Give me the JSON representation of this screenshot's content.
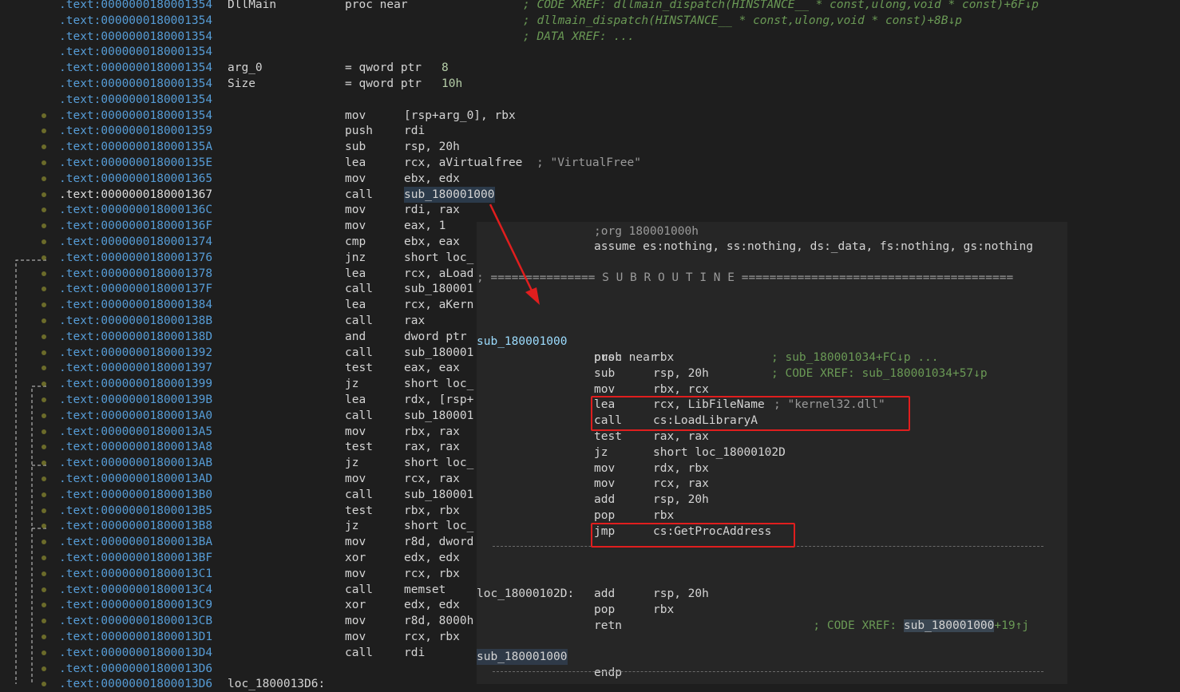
{
  "lines": [
    {
      "addr": ".text:0000000180001354",
      "label": "DllMain",
      "mn": "proc near",
      "op": "",
      "comment": "; CODE XREF: dllmain_dispatch(HINSTANCE__ * const,ulong,void * const)+6F↓p"
    },
    {
      "addr": ".text:0000000180001354",
      "label": "",
      "mn": "",
      "op": "",
      "comment": "; dllmain_dispatch(HINSTANCE__ * const,ulong,void * const)+8B↓p"
    },
    {
      "addr": ".text:0000000180001354",
      "label": "",
      "mn": "",
      "op": "",
      "comment": "; DATA XREF: ..."
    },
    {
      "addr": ".text:0000000180001354",
      "label": "",
      "mn": "",
      "op": "",
      "comment": ""
    },
    {
      "addr": ".text:0000000180001354",
      "label": "arg_0",
      "mn": "= qword ptr",
      "op": "8",
      "comment": ""
    },
    {
      "addr": ".text:0000000180001354",
      "label": "Size",
      "mn": "= qword ptr",
      "op": "10h",
      "comment": ""
    },
    {
      "addr": ".text:0000000180001354",
      "label": "",
      "mn": "",
      "op": "",
      "comment": ""
    },
    {
      "addr": ".text:0000000180001354",
      "label": "",
      "mn": "mov",
      "op": "[rsp+arg_0], rbx",
      "comment": ""
    },
    {
      "addr": ".text:0000000180001359",
      "label": "",
      "mn": "push",
      "op": "rdi",
      "comment": ""
    },
    {
      "addr": ".text:000000018000135A",
      "label": "",
      "mn": "sub",
      "op": "rsp, 20h",
      "comment": ""
    },
    {
      "addr": ".text:000000018000135E",
      "label": "",
      "mn": "lea",
      "op": "rcx, aVirtualfree",
      "comment": "; \"VirtualFree\""
    },
    {
      "addr": ".text:0000000180001365",
      "label": "",
      "mn": "mov",
      "op": "ebx, edx",
      "comment": ""
    },
    {
      "addr": ".text:0000000180001367",
      "label": "",
      "mn": "call",
      "op": "sub_180001000",
      "comment": ""
    },
    {
      "addr": ".text:000000018000136C",
      "label": "",
      "mn": "mov",
      "op": "rdi, rax",
      "comment": ""
    },
    {
      "addr": ".text:000000018000136F",
      "label": "",
      "mn": "mov",
      "op": "eax, 1",
      "comment": ""
    },
    {
      "addr": ".text:0000000180001374",
      "label": "",
      "mn": "cmp",
      "op": "ebx, eax",
      "comment": ""
    },
    {
      "addr": ".text:0000000180001376",
      "label": "",
      "mn": "jnz",
      "op": "short loc_",
      "comment": ""
    },
    {
      "addr": ".text:0000000180001378",
      "label": "",
      "mn": "lea",
      "op": "rcx, aLoad",
      "comment": ""
    },
    {
      "addr": ".text:000000018000137F",
      "label": "",
      "mn": "call",
      "op": "sub_180001",
      "comment": ""
    },
    {
      "addr": ".text:0000000180001384",
      "label": "",
      "mn": "lea",
      "op": "rcx, aKern",
      "comment": ""
    },
    {
      "addr": ".text:000000018000138B",
      "label": "",
      "mn": "call",
      "op": "rax",
      "comment": ""
    },
    {
      "addr": ".text:000000018000138D",
      "label": "",
      "mn": "and",
      "op": "dword ptr",
      "comment": ""
    },
    {
      "addr": ".text:0000000180001392",
      "label": "",
      "mn": "call",
      "op": "sub_180001",
      "comment": ""
    },
    {
      "addr": ".text:0000000180001397",
      "label": "",
      "mn": "test",
      "op": "eax, eax",
      "comment": ""
    },
    {
      "addr": ".text:0000000180001399",
      "label": "",
      "mn": "jz",
      "op": "short loc_",
      "comment": ""
    },
    {
      "addr": ".text:000000018000139B",
      "label": "",
      "mn": "lea",
      "op": "rdx, [rsp+",
      "comment": ""
    },
    {
      "addr": ".text:00000001800013A0",
      "label": "",
      "mn": "call",
      "op": "sub_180001",
      "comment": ""
    },
    {
      "addr": ".text:00000001800013A5",
      "label": "",
      "mn": "mov",
      "op": "rbx, rax",
      "comment": ""
    },
    {
      "addr": ".text:00000001800013A8",
      "label": "",
      "mn": "test",
      "op": "rax, rax",
      "comment": ""
    },
    {
      "addr": ".text:00000001800013AB",
      "label": "",
      "mn": "jz",
      "op": "short loc_",
      "comment": ""
    },
    {
      "addr": ".text:00000001800013AD",
      "label": "",
      "mn": "mov",
      "op": "rcx, rax",
      "comment": ""
    },
    {
      "addr": ".text:00000001800013B0",
      "label": "",
      "mn": "call",
      "op": "sub_180001",
      "comment": ""
    },
    {
      "addr": ".text:00000001800013B5",
      "label": "",
      "mn": "test",
      "op": "rbx, rbx",
      "comment": ""
    },
    {
      "addr": ".text:00000001800013B8",
      "label": "",
      "mn": "jz",
      "op": "short loc_",
      "comment": ""
    },
    {
      "addr": ".text:00000001800013BA",
      "label": "",
      "mn": "mov",
      "op": "r8d, dword",
      "comment": ""
    },
    {
      "addr": ".text:00000001800013BF",
      "label": "",
      "mn": "xor",
      "op": "edx, edx",
      "comment": ""
    },
    {
      "addr": ".text:00000001800013C1",
      "label": "",
      "mn": "mov",
      "op": "rcx, rbx",
      "comment": ""
    },
    {
      "addr": ".text:00000001800013C4",
      "label": "",
      "mn": "call",
      "op": "memset",
      "comment": ""
    },
    {
      "addr": ".text:00000001800013C9",
      "label": "",
      "mn": "xor",
      "op": "edx, edx",
      "comment": ""
    },
    {
      "addr": ".text:00000001800013CB",
      "label": "",
      "mn": "mov",
      "op": "r8d, 8000h",
      "comment": ""
    },
    {
      "addr": ".text:00000001800013D1",
      "label": "",
      "mn": "mov",
      "op": "rcx, rbx",
      "comment": ""
    },
    {
      "addr": ".text:00000001800013D4",
      "label": "",
      "mn": "call",
      "op": "rdi",
      "comment": ""
    },
    {
      "addr": ".text:00000001800013D6",
      "label": "",
      "mn": "",
      "op": "",
      "comment": ""
    },
    {
      "addr": ".text:00000001800013D6",
      "label": "loc_1800013D6:",
      "mn": "",
      "op": "",
      "comment": ""
    }
  ],
  "popup": {
    "org": ";org 180001000h",
    "assume": "assume es:nothing, ss:nothing, ds:_data, fs:nothing, gs:nothing",
    "subroutine_banner": "; =============== S U B R O U T I N E =======================================",
    "func_label": "sub_180001000",
    "func_proc": "proc near",
    "func_xref1": "; CODE XREF: sub_180001034+57↓p",
    "func_xref2": "; sub_180001034+FC↓p ...",
    "instr": [
      {
        "mn": "push",
        "op": "rbx"
      },
      {
        "mn": "sub",
        "op": "rsp, 20h"
      },
      {
        "mn": "mov",
        "op": "rbx, rcx"
      },
      {
        "mn": "lea",
        "op": "rcx, LibFileName",
        "cm": "; \"kernel32.dll\""
      },
      {
        "mn": "call",
        "op": "cs:LoadLibraryA"
      },
      {
        "mn": "test",
        "op": "rax, rax"
      },
      {
        "mn": "jz",
        "op": "short loc_18000102D"
      },
      {
        "mn": "mov",
        "op": "rdx, rbx"
      },
      {
        "mn": "mov",
        "op": "rcx, rax"
      },
      {
        "mn": "add",
        "op": "rsp, 20h"
      },
      {
        "mn": "pop",
        "op": "rbx"
      },
      {
        "mn": "jmp",
        "op": "cs:GetProcAddress"
      }
    ],
    "loc_label": "loc_18000102D:",
    "loc_xref_prefix": "; CODE XREF: ",
    "loc_xref_target": "sub_180001000",
    "loc_xref_suffix": "+19↑j",
    "loc_instr": [
      {
        "mn": "add",
        "op": "rsp, 20h"
      },
      {
        "mn": "pop",
        "op": "rbx"
      },
      {
        "mn": "retn",
        "op": ""
      }
    ],
    "end_label": "sub_180001000",
    "end_mn": "endp",
    "end_semicolon": ";"
  },
  "colors": {
    "annotation": "#e01e1e",
    "address": "#569cd6",
    "comment": "#6a9955"
  }
}
